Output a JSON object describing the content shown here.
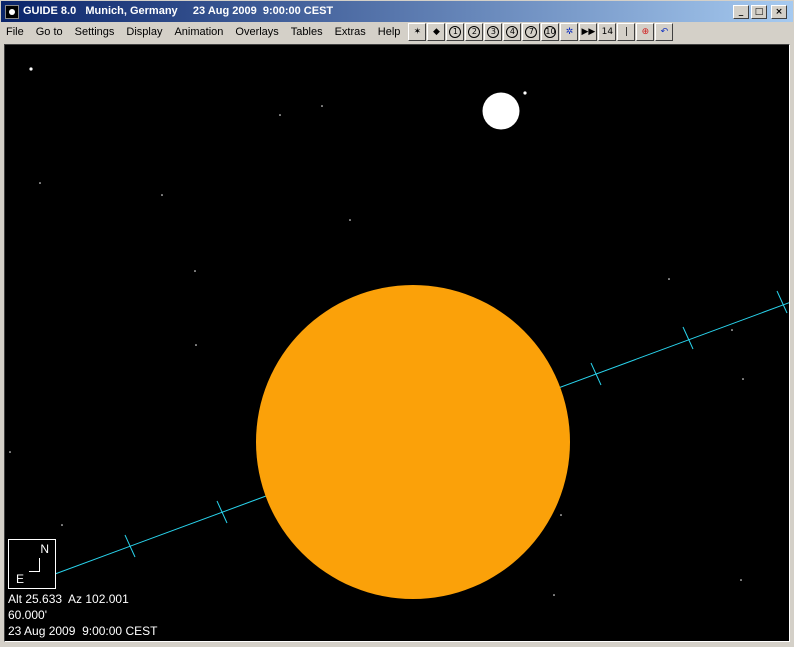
{
  "window": {
    "title": "GUIDE 8.0   Munich, Germany     23 Aug 2009  9:00:00 CEST",
    "buttons": {
      "minimize": "_",
      "maximize": "□",
      "close": "×"
    }
  },
  "menu": {
    "items": [
      "File",
      "Go to",
      "Settings",
      "Display",
      "Animation",
      "Overlays",
      "Tables",
      "Extras",
      "Help"
    ]
  },
  "toolbar": {
    "buttons": [
      {
        "label": "✶",
        "icon": "star-chart-icon"
      },
      {
        "label": "◆",
        "icon": "planet-icon"
      },
      {
        "label": "1",
        "icon": "zoom-level-1-icon",
        "circled": true
      },
      {
        "label": "2",
        "icon": "zoom-level-2-icon",
        "circled": true
      },
      {
        "label": "3",
        "icon": "zoom-level-3-icon",
        "circled": true
      },
      {
        "label": "4",
        "icon": "zoom-level-4-icon",
        "circled": true
      },
      {
        "label": "7",
        "icon": "zoom-level-7-icon",
        "circled": true
      },
      {
        "label": "10",
        "icon": "zoom-level-10-icon",
        "circled": true
      },
      {
        "label": "✲",
        "icon": "stars-icon"
      },
      {
        "label": "▶▶",
        "icon": "fast-forward-icon"
      },
      {
        "label": "14",
        "icon": "level-14-icon"
      },
      {
        "label": "|",
        "icon": "separator-icon"
      },
      {
        "label": "⊕",
        "icon": "crosshair-icon"
      },
      {
        "label": "↶",
        "icon": "undo-icon"
      }
    ]
  },
  "sky": {
    "compass": {
      "north": "N",
      "east": "E"
    },
    "readout": {
      "altaz": "Alt 25.633  Az 102.001",
      "field": "60.000'",
      "datetime": "23 Aug 2009  9:00:00 CEST"
    },
    "colors": {
      "background": "#000000",
      "sun": "#fba109",
      "ecliptic": "#29d3ec",
      "moon": "#ffffff"
    }
  }
}
